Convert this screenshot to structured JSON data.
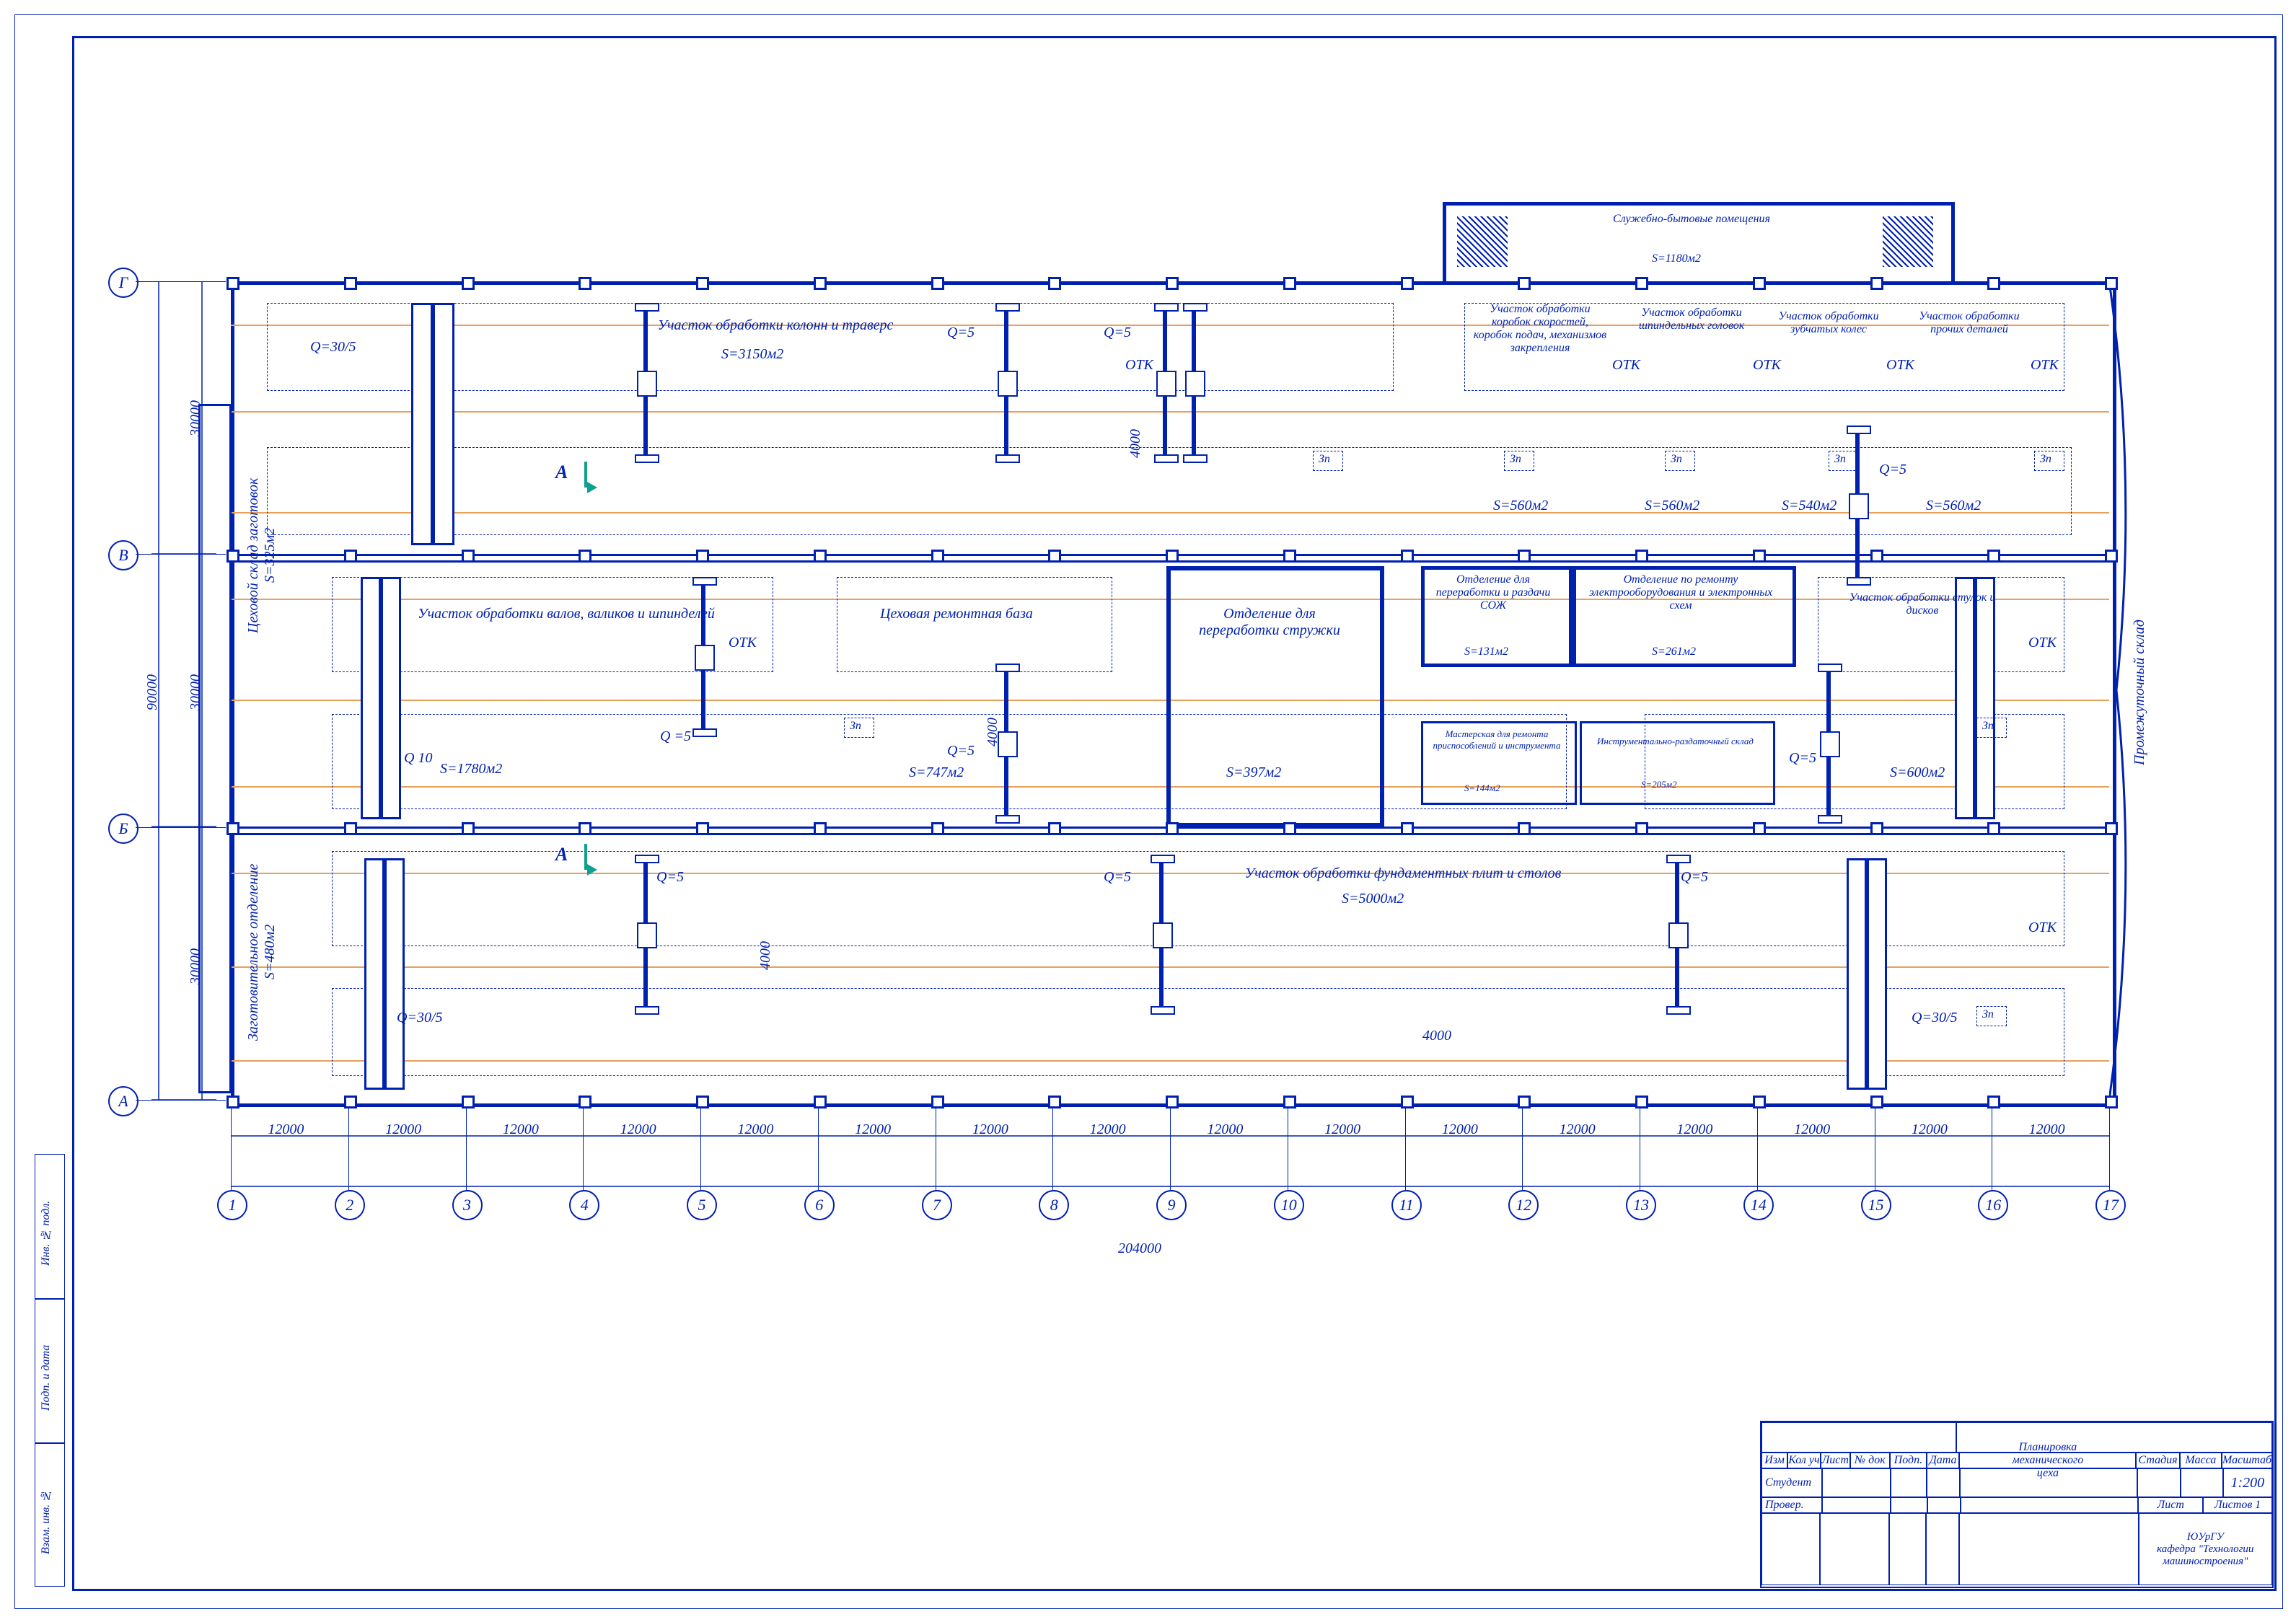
{
  "title_block": {
    "drawing_title_1": "Планировка",
    "drawing_title_2": "механического",
    "drawing_title_3": "цеха",
    "scale_label": "Масштаб",
    "scale": "1:200",
    "stage": "Стадия",
    "mass": "Масса",
    "sheet": "Лист",
    "sheets": "Листов 1",
    "org_1": "ЮУрГУ",
    "org_2": "кафедра \"Технологии",
    "org_3": "машиностроения\"",
    "hdr": [
      "Изм",
      "Кол уч",
      "Лист",
      "№ док",
      "Подп.",
      "Дата"
    ],
    "rows": [
      "Студент",
      "Провер."
    ]
  },
  "axes_v": [
    "А",
    "Б",
    "В",
    "Г"
  ],
  "axes_h": [
    "1",
    "2",
    "3",
    "4",
    "5",
    "6",
    "7",
    "8",
    "9",
    "10",
    "11",
    "12",
    "13",
    "14",
    "15",
    "16",
    "17"
  ],
  "dims": {
    "total_w": "204000",
    "total_h": "90000",
    "bay_v": "30000",
    "bay_h": "12000",
    "pass": "4000"
  },
  "rooms": {
    "r1": {
      "name": "Участок обработки колонн и траверс",
      "area": "S=3150м2"
    },
    "r2": {
      "name": "Участок обработки валов, валиков и шпинделей",
      "area": "S=1780м2"
    },
    "r3": {
      "name": "Цеховая ремонтная база",
      "area": "S=747м2"
    },
    "r4": {
      "name": "Отделение для переработки стружки",
      "area": "S=397м2"
    },
    "r5": {
      "name": "Отделение для переработки и раздачи СОЖ",
      "area": "S=131м2"
    },
    "r6": {
      "name": "Отделение по ремонту электрооборудования и электронных схем",
      "area": "S=261м2"
    },
    "r7": {
      "name": "Мастерская для ремонта приспособлений и инструмента",
      "area": "S=144м2"
    },
    "r8": {
      "name": "Инструментально-раздаточный склад",
      "area": "S=205м2"
    },
    "r9": {
      "name": "Участок обработки фундаментных плит и столов",
      "area": "S=5000м2"
    },
    "r10": {
      "name": "Участок обработки коробок скоростей, коробок подач, механизмов закрепления",
      "area": "S=560м2"
    },
    "r11": {
      "name": "Участок обработки шпиндельных головок",
      "area": "S=560м2"
    },
    "r12": {
      "name": "Участок обработки зубчатых колес",
      "area": "S=540м2"
    },
    "r13": {
      "name": "Участок обработки прочих деталей",
      "area": "S=560м2"
    },
    "r14": {
      "name": "Участок обработки втулок и дисков",
      "area": "S=600м2"
    },
    "r15": {
      "name": "ОТК"
    },
    "r16": {
      "name": "Зп"
    },
    "r17": {
      "name": "Служебно-бытовые помещения",
      "area": "S=1180м2"
    }
  },
  "annot": {
    "left1": "Цеховой склад заготовок\nS=325м2",
    "left2": "Заготовительное отделение\nS=480м2",
    "right": "Промежуточный склад"
  },
  "cranes": {
    "q30_5": "Q=30/5",
    "q10": "Q 10",
    "q5": "Q=5",
    "q_5": "Q =5"
  },
  "section": "А",
  "side_labels": [
    "Взам. инв. №",
    "Подп. и дата",
    "Инв. № подл."
  ]
}
